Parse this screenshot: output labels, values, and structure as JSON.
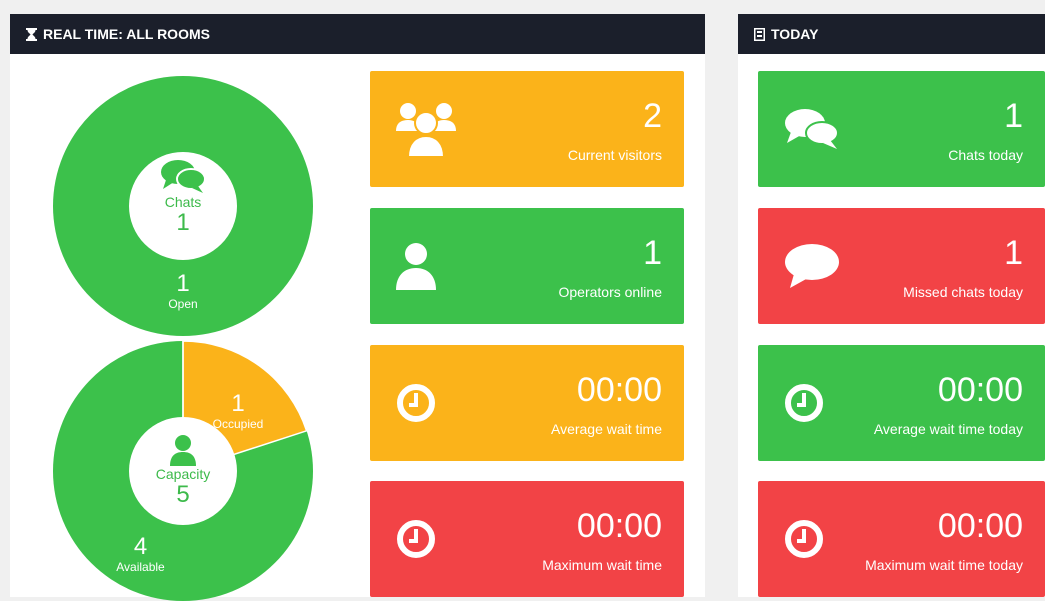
{
  "realtime": {
    "title": "REAL TIME: ALL ROOMS",
    "chats_donut": {
      "center_label": "Chats",
      "center_value": "1",
      "open_value": "1",
      "open_label": "Open"
    },
    "capacity_donut": {
      "center_label": "Capacity",
      "center_value": "5",
      "occupied_value": "1",
      "occupied_label": "Occupied",
      "available_value": "4",
      "available_label": "Available"
    },
    "cards": [
      {
        "value": "2",
        "label": "Current visitors",
        "icon": "group-icon",
        "color": "#fbb31a"
      },
      {
        "value": "1",
        "label": "Operators online",
        "icon": "user-icon",
        "color": "#3cc14b"
      },
      {
        "value": "00:00",
        "label": "Average wait time",
        "icon": "clock-icon",
        "color": "#fbb31a"
      },
      {
        "value": "00:00",
        "label": "Maximum wait time",
        "icon": "clock-icon",
        "color": "#f24346"
      }
    ]
  },
  "today": {
    "title": "TODAY",
    "cards": [
      {
        "value": "1",
        "label": "Chats today",
        "icon": "chat-bubbles-icon",
        "color": "#3cc14b"
      },
      {
        "value": "1",
        "label": "Missed chats today",
        "icon": "chat-bubble-icon",
        "color": "#f24346"
      },
      {
        "value": "00:00",
        "label": "Average wait time today",
        "icon": "clock-icon",
        "color": "#3cc14b"
      },
      {
        "value": "00:00",
        "label": "Maximum wait time today",
        "icon": "clock-icon",
        "color": "#f24346"
      }
    ]
  },
  "colors": {
    "green": "#3cc14b",
    "orange": "#fbb31a",
    "red": "#f24346",
    "header": "#1b1f2b"
  }
}
